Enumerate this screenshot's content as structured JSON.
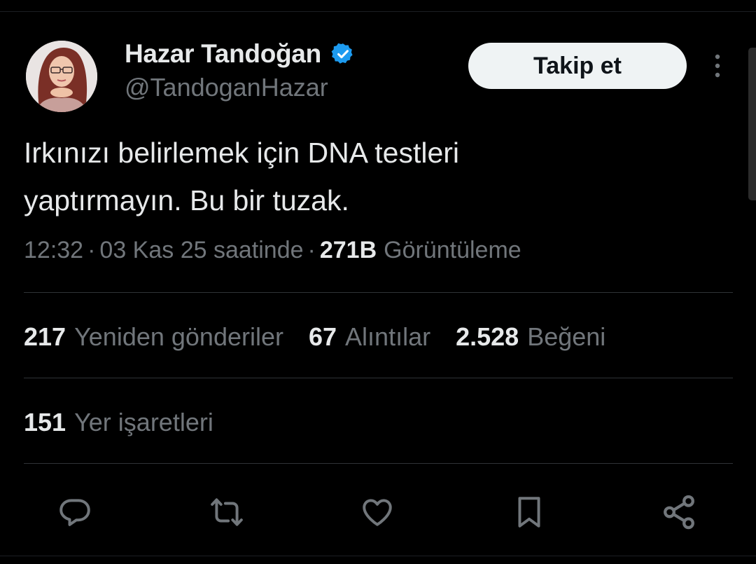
{
  "tweet": {
    "author": {
      "display_name": "Hazar Tandoğan",
      "handle": "@TandoganHazar",
      "verified": true
    },
    "follow_label": "Takip et",
    "text": "Irkınızı belirlemek için DNA testleri\nyaptırmayın. Bu bir tuzak.",
    "time": "12:32",
    "date": "03 Kas 25 saatinde",
    "separator": "·",
    "views_count": "271B",
    "views_label": "Görüntüleme",
    "stats": {
      "reposts_count": "217",
      "reposts_label": "Yeniden gönderiler",
      "quotes_count": "67",
      "quotes_label": "Alıntılar",
      "likes_count": "2.528",
      "likes_label": "Beğeni",
      "bookmarks_count": "151",
      "bookmarks_label": "Yer işaretleri"
    }
  },
  "icons": {
    "verified": "verified-badge-icon",
    "more": "more-vertical-icon",
    "reply": "reply-icon",
    "repost": "repost-icon",
    "like": "heart-icon",
    "bookmark": "bookmark-icon",
    "share": "share-icon"
  },
  "colors": {
    "background": "#000000",
    "primary_text": "#e7e9ea",
    "secondary_text": "#71767b",
    "divider": "#2f3336",
    "verified_blue": "#1d9bf0",
    "button_bg": "#eff3f4",
    "button_text": "#0f1419"
  }
}
